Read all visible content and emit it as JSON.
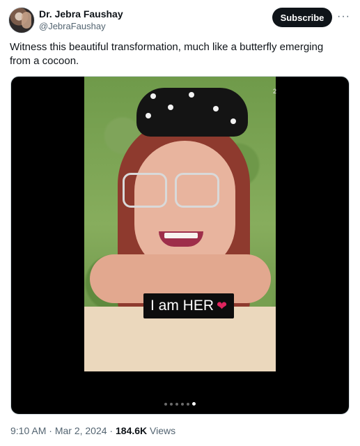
{
  "author": {
    "display_name": "Dr. Jebra Faushay",
    "handle": "@JebraFaushay"
  },
  "header": {
    "subscribe_label": "Subscribe",
    "more_icon": "more-horizontal-icon"
  },
  "tweet": {
    "text": "Witness this beautiful transformation, much like a butterfly emerging from a cocoon."
  },
  "media": {
    "caption": "I am HER",
    "caption_icon": "heart-icon",
    "corner_mark": "2",
    "page_count": 6,
    "active_page": 6
  },
  "meta": {
    "time": "9:10 AM",
    "sep1": " · ",
    "date": "Mar 2, 2024",
    "sep2": " · ",
    "views_count": "184.6K",
    "views_label": " Views"
  }
}
